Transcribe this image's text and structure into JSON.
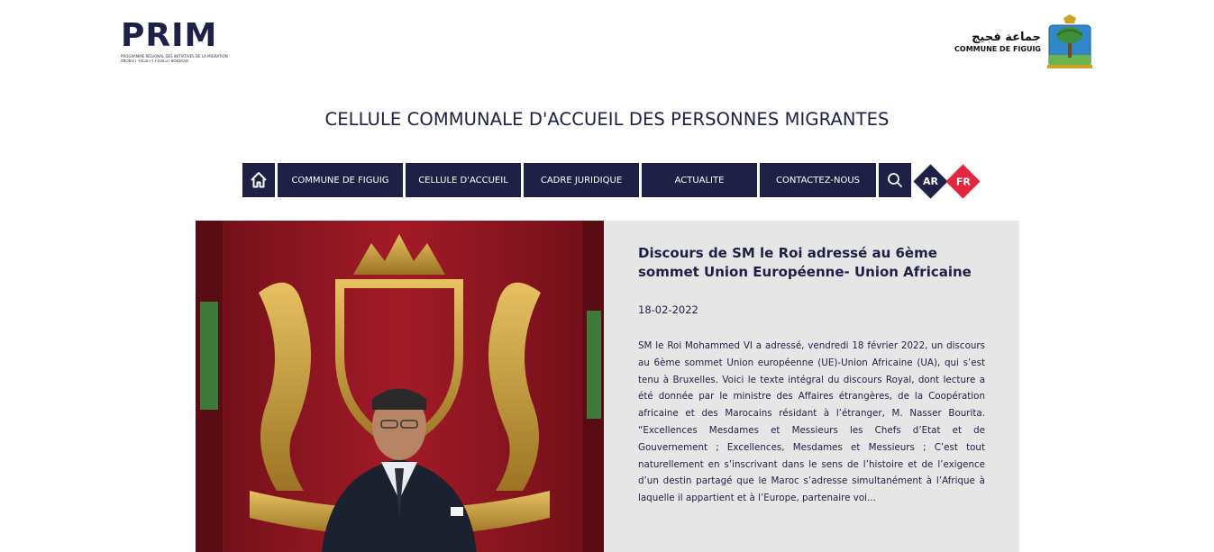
{
  "header": {
    "prim_logo": {
      "word": "PRIM",
      "tagline_1": "PROGRAMME RÉGIONAL DES INITIATIVES DE LA MIGRATION",
      "tagline_2": "ⵉⴳⵔⵓⵙ ⵏ ⵜⵎⵏⴰⴹⵜ ⵏ ⵜⵉⵡⵏⵏⴰⵏ ⵏ ⵓⵙⵎⵓⴷⴷⵓ"
    },
    "figuig_logo": {
      "arabic": "جماعة فجيج",
      "french": "COMMUNE DE FIGUIG"
    },
    "title": "CELLULE COMMUNALE D'ACCUEIL DES PERSONNES MIGRANTES"
  },
  "nav": {
    "home_icon": "home-icon",
    "items": [
      {
        "label": "COMMUNE DE FIGUIG"
      },
      {
        "label": "CELLULE D'ACCUEIL"
      },
      {
        "label": "CADRE JURIDIQUE"
      },
      {
        "label": "ACTUALITE"
      },
      {
        "label": "CONTACTEZ-NOUS"
      }
    ],
    "search_icon": "search-icon",
    "languages": [
      {
        "label": "AR",
        "color": "#1e2046"
      },
      {
        "label": "FR",
        "color": "#e1263d"
      }
    ]
  },
  "article": {
    "title": "Discours de SM le Roi adressé au 6ème sommet Union Européenne- Union Africaine",
    "date": "18-02-2022",
    "excerpt": "SM le Roi Mohammed VI a adressé, vendredi 18 février 2022, un discours au 6ème sommet Union européenne (UE)-Union Africaine (UA), qui s’est tenu à Bruxelles. Voici le texte intégral du discours Royal, dont lecture a été donnée par le ministre des Affaires étrangères, de la Coopération africaine et des Marocains résidant à l’étranger, M. Nasser Bourita. “Excellences Mesdames et Messieurs les Chefs d’Etat et de Gouvernement ; Excellences, Mesdames et Messieurs ; C’est tout naturellement en s’inscrivant dans le sens de l’histoire et de l’exigence d’un destin partagé que le Maroc s’adresse simultanément à l’Afrique à laquelle il appartient et à l’Europe, partenaire voi..."
  },
  "colors": {
    "navy": "#1e2046",
    "red": "#e1263d",
    "card_bg": "#e6e6e6"
  }
}
